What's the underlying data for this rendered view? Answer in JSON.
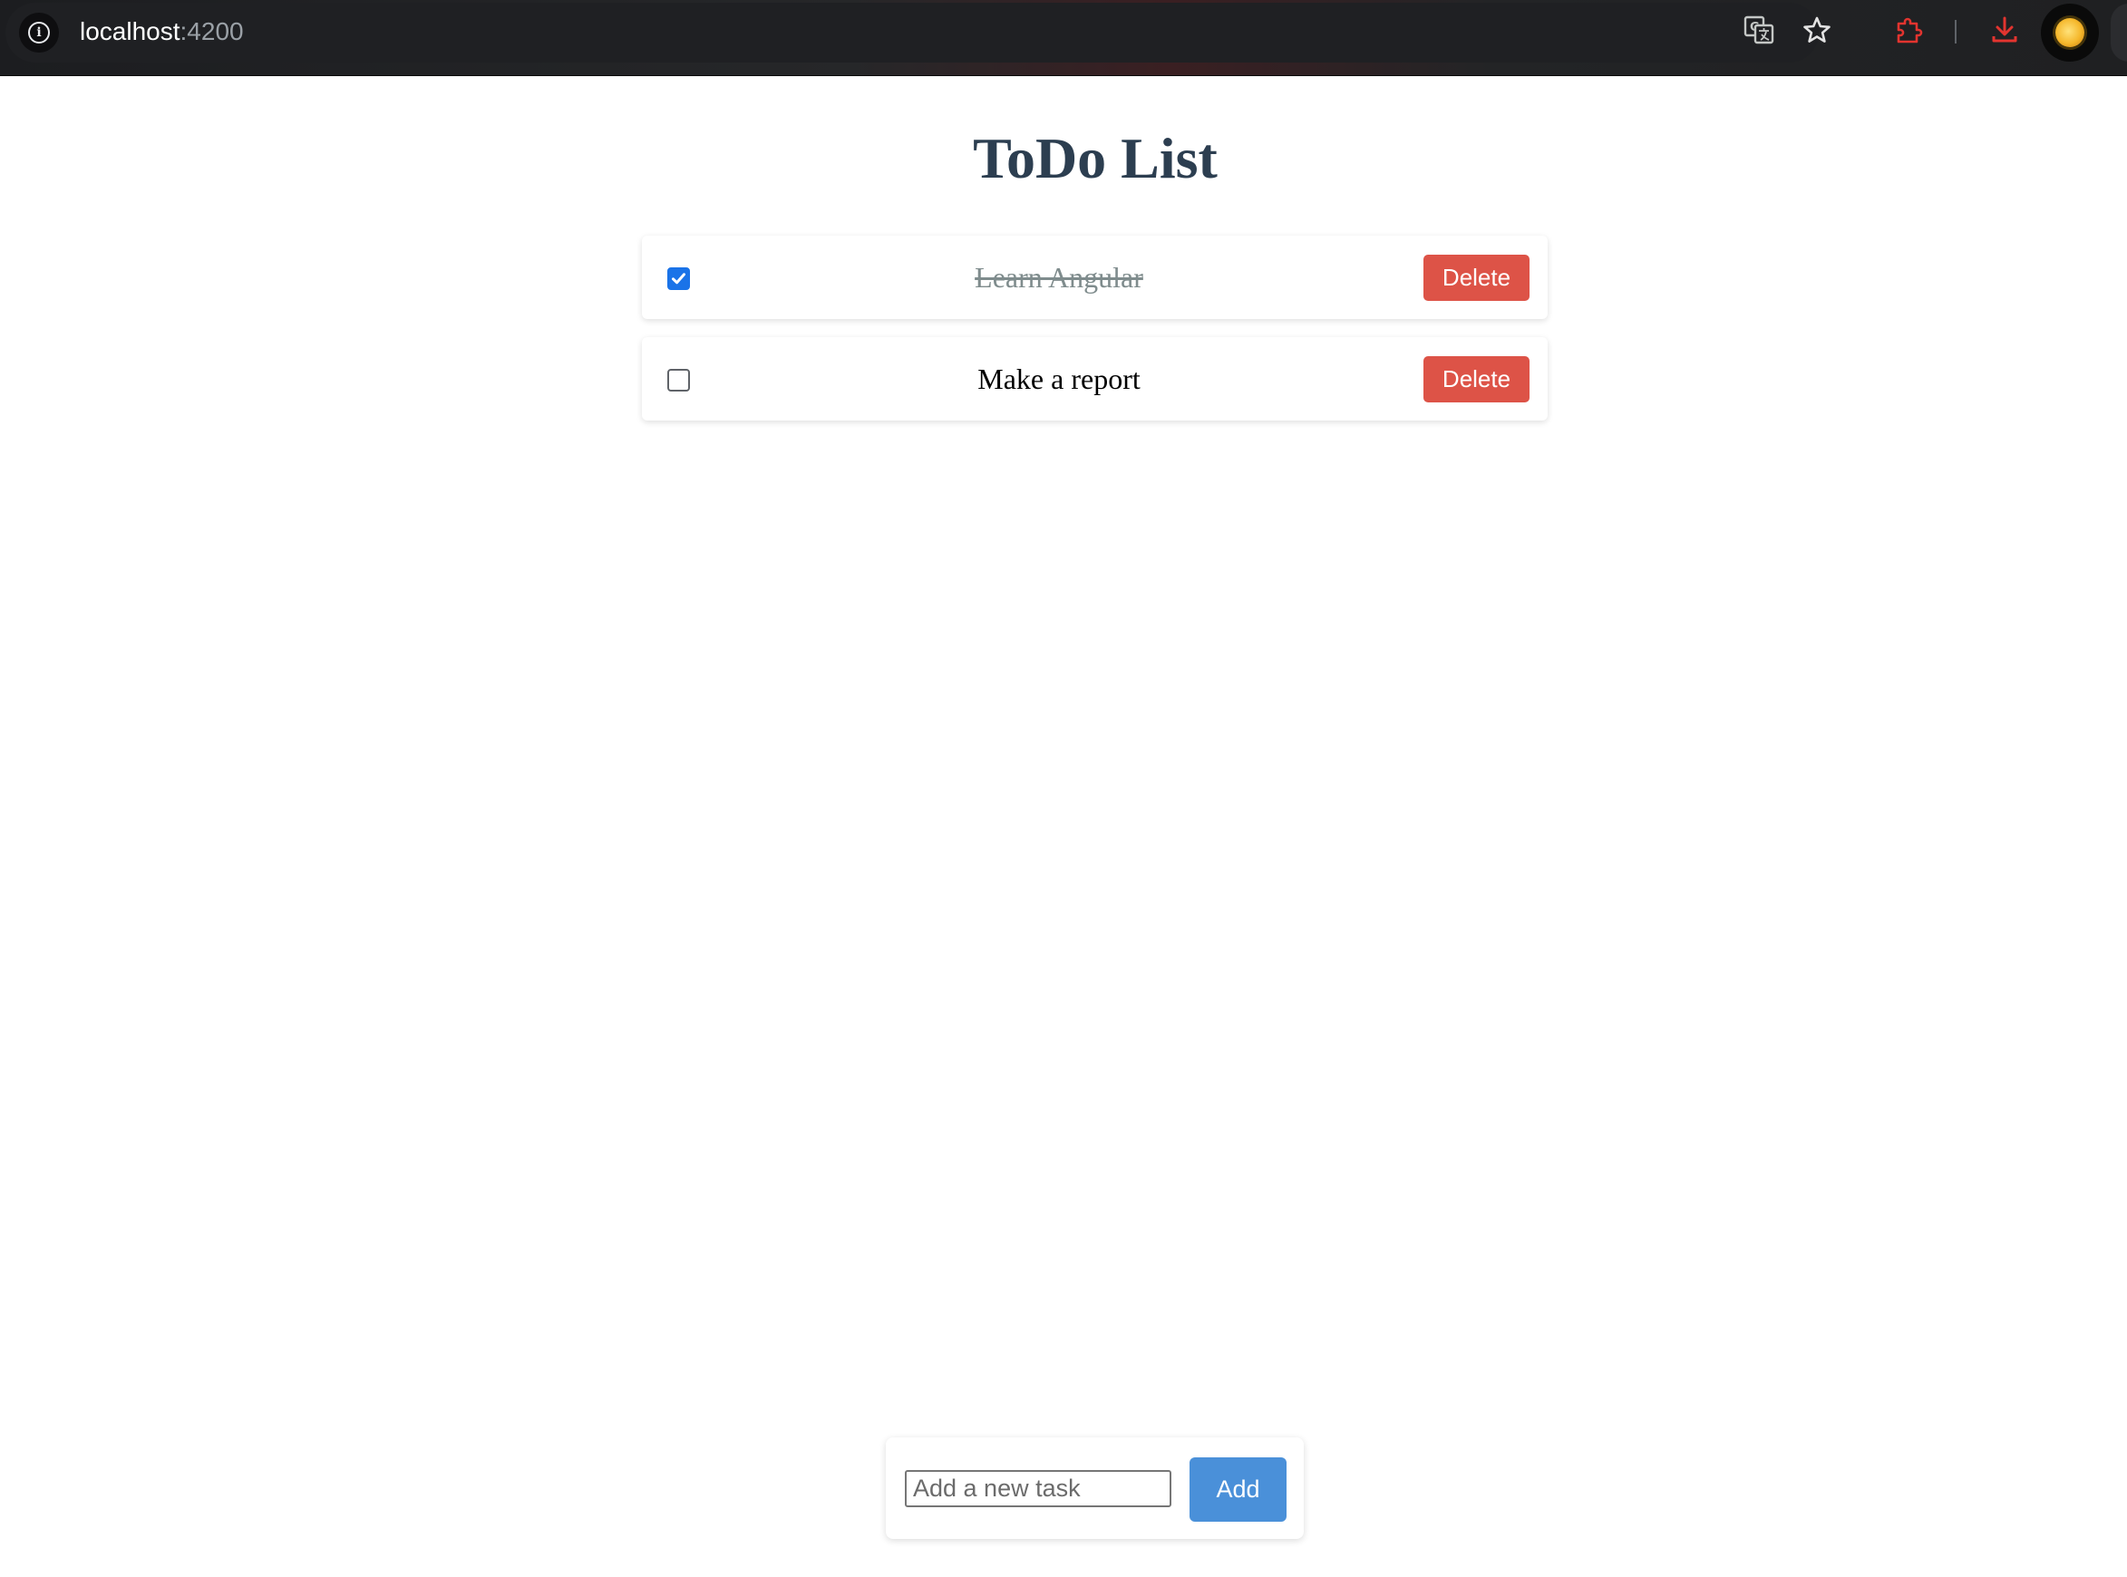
{
  "browser": {
    "url_host": "localhost",
    "url_port": ":4200",
    "icons": [
      "info-icon",
      "translate-icon",
      "star-icon",
      "extensions-icon",
      "download-icon",
      "profile-avatar"
    ]
  },
  "app": {
    "title": "ToDo List",
    "todos": [
      {
        "text": "Learn Angular",
        "completed": true,
        "delete_label": "Delete"
      },
      {
        "text": "Make a report",
        "completed": false,
        "delete_label": "Delete"
      }
    ],
    "new_task": {
      "value": "",
      "placeholder": "Add a new task",
      "add_label": "Add"
    }
  },
  "colors": {
    "title": "#2c3e50",
    "delete_button": "#dd5347",
    "add_button": "#4a90d9",
    "checkbox_checked": "#1a73e8",
    "completed_text": "#7f8c8d"
  }
}
